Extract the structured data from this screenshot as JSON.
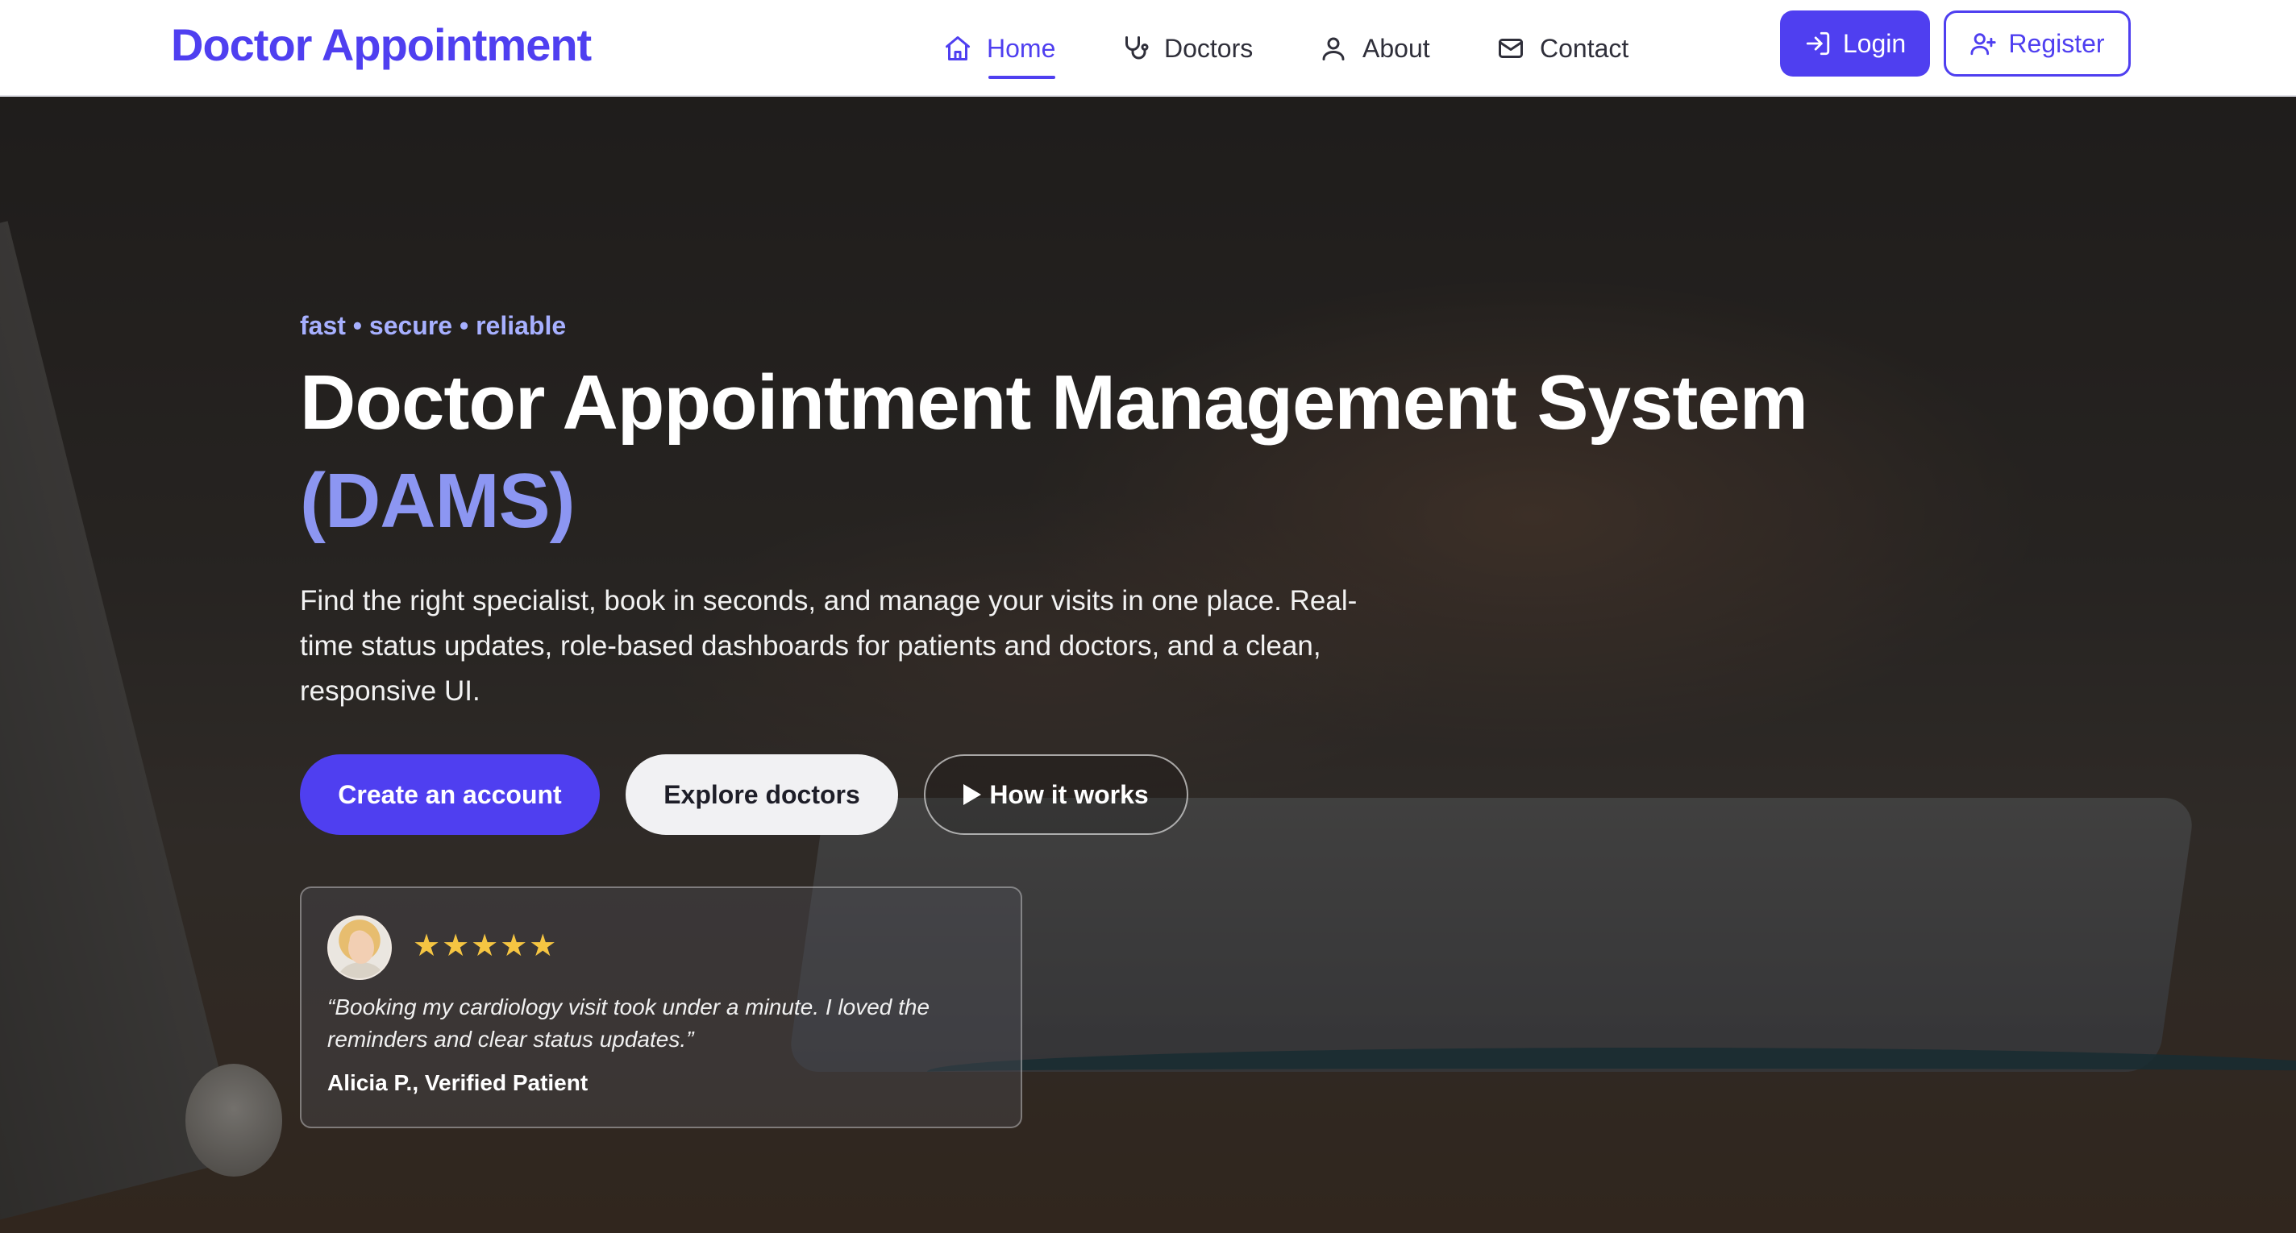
{
  "navbar": {
    "brand": "Doctor Appointment",
    "links": [
      {
        "label": "Home",
        "icon": "home-icon",
        "active": true
      },
      {
        "label": "Doctors",
        "icon": "stethoscope-icon",
        "active": false
      },
      {
        "label": "About",
        "icon": "user-icon",
        "active": false
      },
      {
        "label": "Contact",
        "icon": "mail-icon",
        "active": false
      }
    ],
    "login_label": "Login",
    "register_label": "Register"
  },
  "hero": {
    "tagline": "fast • secure • reliable",
    "title": "Doctor Appointment Management System",
    "title_highlight": "(DAMS)",
    "description": "Find the right specialist, book in seconds, and manage your visits in one place. Real-time status updates, role-based dashboards for patients and doctors, and a clean, responsive UI.",
    "buttons": {
      "primary": "Create an account",
      "secondary": "Explore doctors",
      "outline": "How it works"
    }
  },
  "testimonial": {
    "stars": "★★★★★",
    "rating": 5,
    "quote": "“Booking my cardiology visit took under a minute. I loved the reminders and clear status updates.”",
    "author": "Alicia P., Verified Patient"
  },
  "colors": {
    "brand": "#4f3ff0",
    "tagline": "#a7b0ff",
    "highlight": "#8c96f2",
    "star": "#f5c542"
  }
}
